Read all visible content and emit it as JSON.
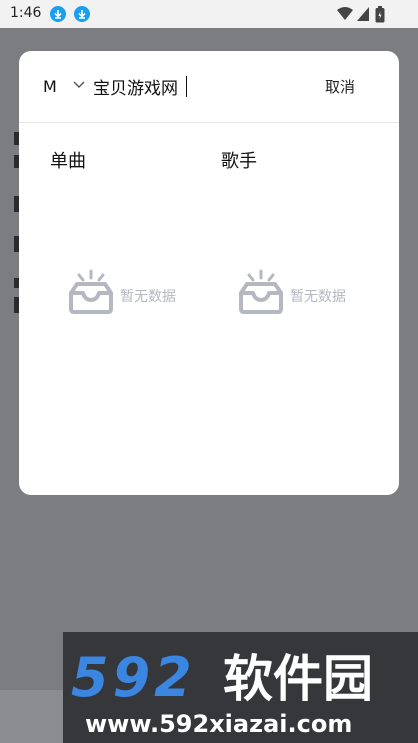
{
  "status_bar": {
    "time": "1:46"
  },
  "search": {
    "mode": "M",
    "value": "宝贝游戏网",
    "cancel_label": "取消"
  },
  "columns": [
    {
      "title": "单曲",
      "empty_text": "暂无数据"
    },
    {
      "title": "歌手",
      "empty_text": "暂无数据"
    }
  ],
  "watermark": {
    "brand_number": "592",
    "brand_text": "软件园",
    "url": "www.592xiazai.com"
  },
  "colors": {
    "download_icon": "#1aa0f0",
    "empty_icon": "#b5b8c0",
    "brand_blue": "#3b86e0"
  }
}
